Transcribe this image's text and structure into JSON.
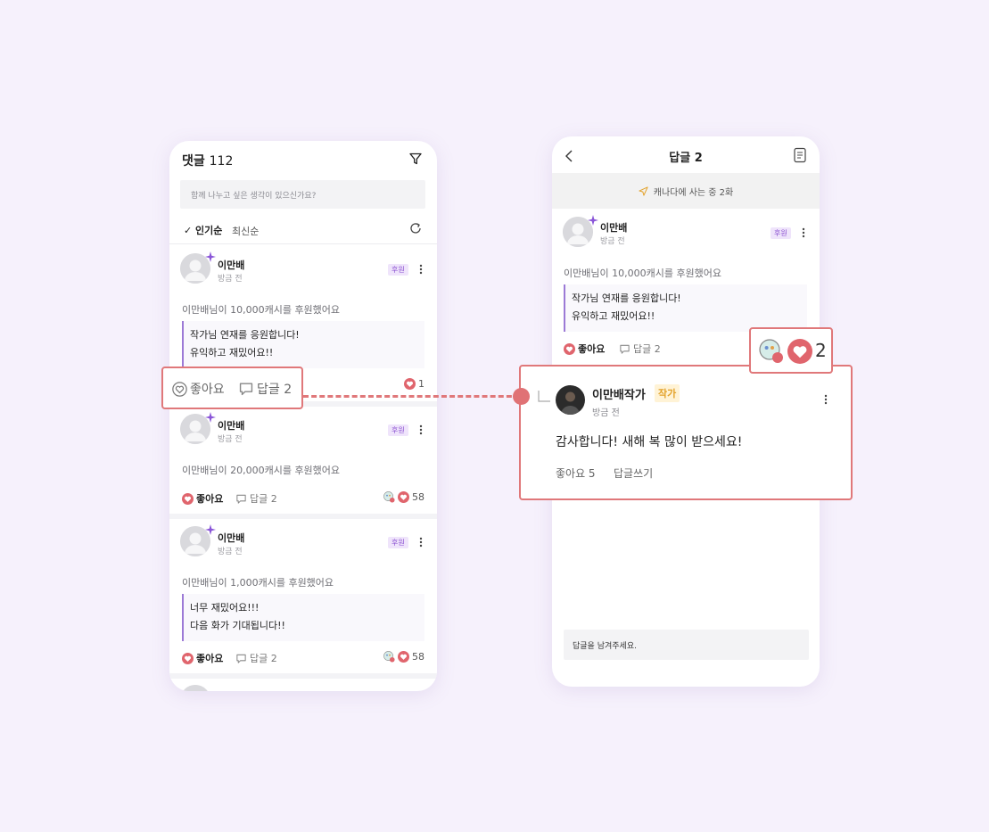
{
  "left": {
    "title": "댓글",
    "count": "112",
    "input_placeholder": "함께 나누고 싶은 생각이 있으신가요?",
    "sort_popular": "✓ 인기순",
    "sort_latest": "최신순",
    "comments": [
      {
        "name": "이만배",
        "time": "방금 전",
        "badge": "후원",
        "donation": "이만배님이 10,000캐시를 후원했어요",
        "lines": [
          "작가님 연재를 응원합니다!",
          "유익하고 재밌어요!!"
        ],
        "like_count": "1"
      },
      {
        "name": "이만배",
        "time": "방금 전",
        "badge": "후원",
        "donation": "이만배님이 20,000캐시를 후원했어요",
        "like_label": "좋아요",
        "reply_label": "답글 2",
        "like_count": "58"
      },
      {
        "name": "이만배",
        "time": "방금 전",
        "badge": "후원",
        "donation": "이만배님이 1,000캐시를 후원했어요",
        "lines": [
          "너무 재밌어요!!!",
          "다음 화가 기대됩니다!!"
        ],
        "like_label": "좋아요",
        "reply_label": "답글 2",
        "like_count": "58"
      }
    ]
  },
  "right": {
    "title": "답글 2",
    "banner": "캐나다에 사는 중 2화",
    "comment": {
      "name": "이만배",
      "time": "방금 전",
      "badge": "후원",
      "donation": "이만배님이 10,000캐시를 후원했어요",
      "lines": [
        "작가님 연재를 응원합니다!",
        "유익하고 재밌어요!!"
      ],
      "like_label": "좋아요",
      "reply_label": "답글 2"
    },
    "reply_placeholder": "답글을 남겨주세요."
  },
  "callouts": {
    "actions": {
      "like_label": "좋아요",
      "reply_label": "답글 2"
    },
    "author_reply": {
      "name": "이만배작가",
      "badge": "작가",
      "time": "방금 전",
      "text": "감사합니다! 새해 복 많이 받으세요!",
      "like_label": "좋아요 5",
      "reply_write": "답글쓰기"
    },
    "likes": {
      "count": "2"
    }
  },
  "colors": {
    "background": "#f6f1fc",
    "heart": "#e0656d",
    "callout_border": "#e0787a",
    "sponsor_badge": "#8a4fd0",
    "author_badge_bg": "#fff3d6",
    "author_badge_text": "#e3a22a"
  },
  "icons": [
    "filter-icon",
    "refresh-icon",
    "heart-icon",
    "speech-bubble-icon",
    "kebab-icon",
    "sparkle-icon",
    "back-icon",
    "document-icon",
    "send-icon"
  ]
}
